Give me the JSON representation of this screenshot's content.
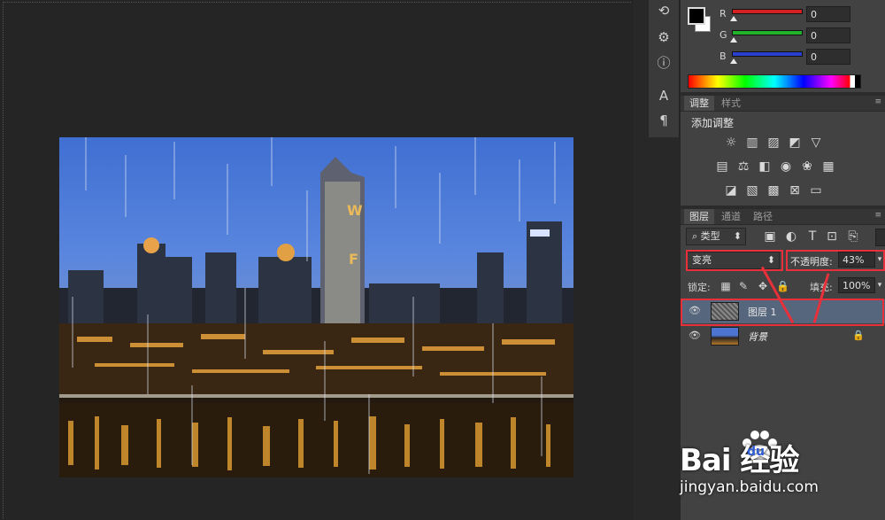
{
  "color_panel": {
    "channels": [
      {
        "label": "R",
        "value": "0",
        "color": "#d42020"
      },
      {
        "label": "G",
        "value": "0",
        "color": "#21b12b"
      },
      {
        "label": "B",
        "value": "0",
        "color": "#2a3fd0"
      }
    ],
    "foreground": "#000000",
    "background": "#ffffff"
  },
  "adjustments_panel": {
    "tabs": [
      "调整",
      "样式"
    ],
    "heading": "添加调整",
    "icon_rows": [
      [
        "brightness-contrast-icon",
        "levels-icon",
        "curves-icon",
        "exposure-icon",
        "vibrance-icon"
      ],
      [
        "hue-saturation-icon",
        "color-balance-icon",
        "black-white-icon",
        "photo-filter-icon",
        "channel-mixer-icon",
        "color-lookup-icon"
      ],
      [
        "invert-icon",
        "posterize-icon",
        "threshold-icon",
        "selective-color-icon",
        "gradient-map-icon"
      ]
    ]
  },
  "layers_panel": {
    "tabs": [
      "图层",
      "通道",
      "路径"
    ],
    "filter_kind": "类型",
    "blend_mode": "变亮",
    "opacity_label": "不透明度:",
    "opacity_value": "43%",
    "lock_label": "锁定:",
    "fill_label": "填充:",
    "fill_value": "100%",
    "layers": [
      {
        "name": "图层 1",
        "selected": true,
        "locked": false
      },
      {
        "name": "背景",
        "selected": false,
        "locked": true
      }
    ]
  },
  "watermark": {
    "logo_text": "Bai 经验",
    "logo_du": "du",
    "url": "jingyan.baidu.com"
  },
  "accent": {
    "annotation_red": "#e8303a",
    "selection_blue": "#55667d"
  }
}
